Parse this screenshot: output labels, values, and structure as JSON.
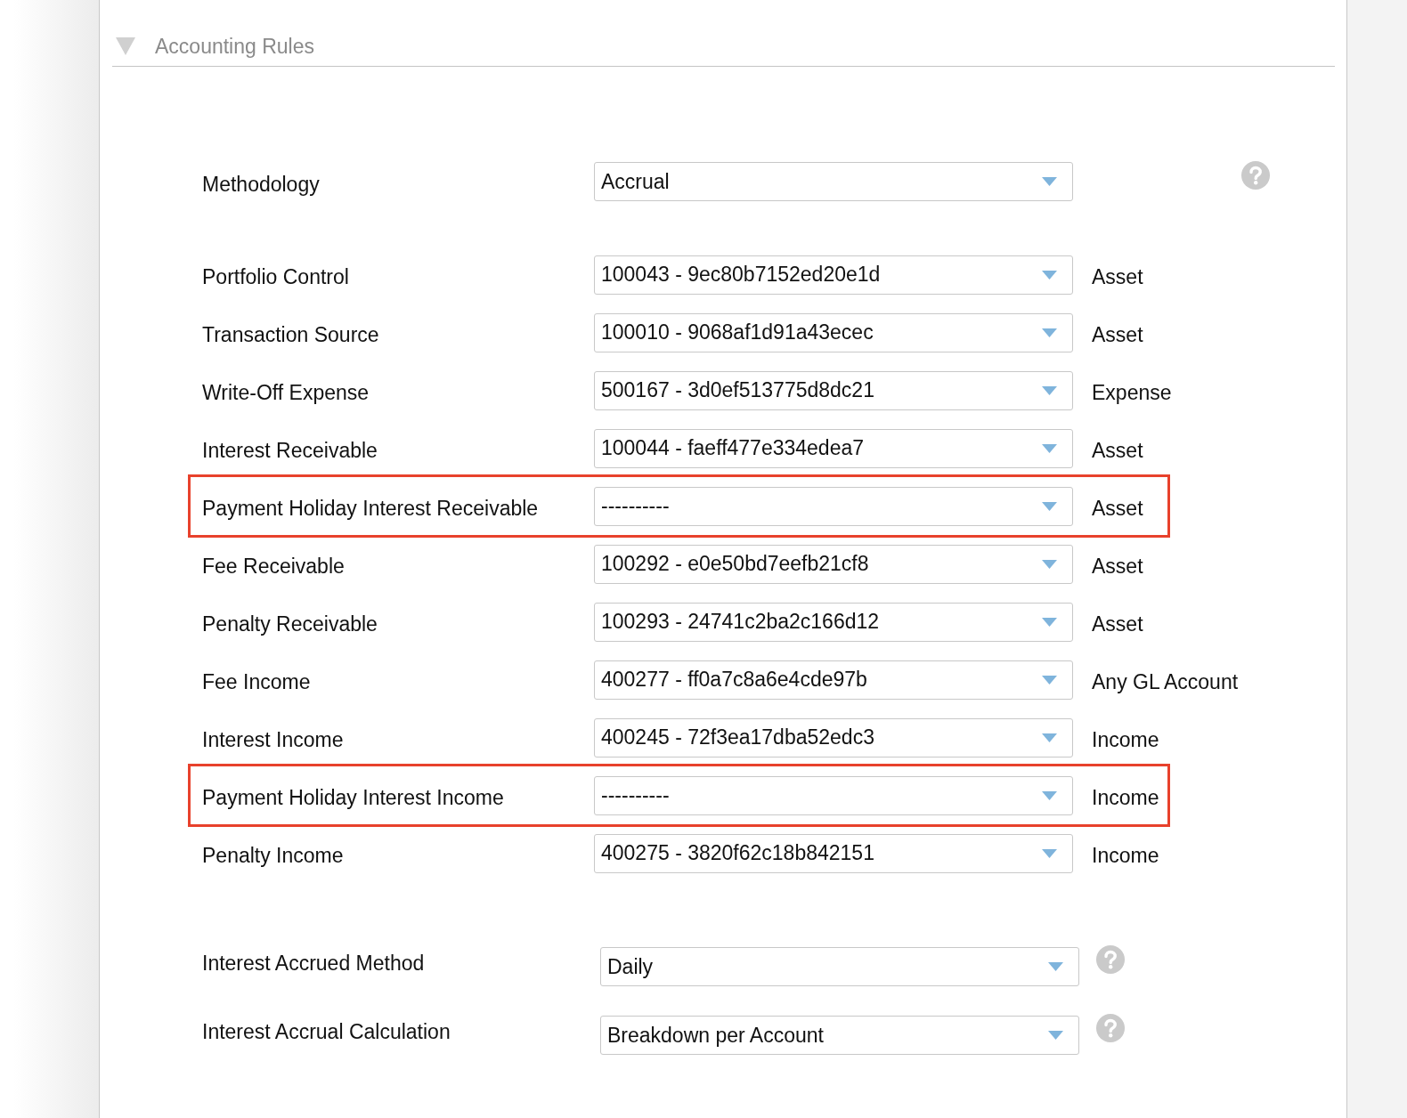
{
  "section": {
    "title": "Accounting Rules",
    "expanded": true
  },
  "methodology": {
    "label": "Methodology",
    "value": "Accrual"
  },
  "accounts": [
    {
      "label": "Portfolio Control",
      "value": "100043 - 9ec80b7152ed20e1d",
      "type": "Asset",
      "highlighted": false
    },
    {
      "label": "Transaction Source",
      "value": "100010 - 9068af1d91a43ecec",
      "type": "Asset",
      "highlighted": false
    },
    {
      "label": "Write-Off Expense",
      "value": "500167 - 3d0ef513775d8dc21",
      "type": "Expense",
      "highlighted": false
    },
    {
      "label": "Interest Receivable",
      "value": "100044 - faeff477e334edea7",
      "type": "Asset",
      "highlighted": false
    },
    {
      "label": "Payment Holiday Interest Receivable",
      "value": "----------",
      "type": "Asset",
      "highlighted": true
    },
    {
      "label": "Fee Receivable",
      "value": "100292 - e0e50bd7eefb21cf8",
      "type": "Asset",
      "highlighted": false
    },
    {
      "label": "Penalty Receivable",
      "value": "100293 - 24741c2ba2c166d12",
      "type": "Asset",
      "highlighted": false
    },
    {
      "label": "Fee Income",
      "value": "400277 - ff0a7c8a6e4cde97b",
      "type": "Any GL Account",
      "highlighted": false
    },
    {
      "label": "Interest Income",
      "value": "400245 - 72f3ea17dba52edc3",
      "type": "Income",
      "highlighted": false
    },
    {
      "label": "Payment Holiday Interest Income",
      "value": "----------",
      "type": "Income",
      "highlighted": true
    },
    {
      "label": "Penalty Income",
      "value": "400275 - 3820f62c18b842151",
      "type": "Income",
      "highlighted": false
    }
  ],
  "accrual_settings": [
    {
      "label": "Interest Accrued Method",
      "value": "Daily"
    },
    {
      "label": "Interest Accrual Calculation",
      "value": "Breakdown per Account"
    }
  ]
}
